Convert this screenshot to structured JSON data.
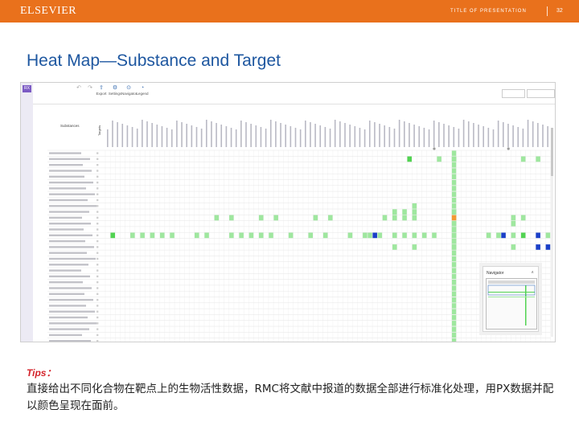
{
  "header": {
    "brand": "ELSEVIER",
    "deck_title": "TITLE OF PRESENTATION",
    "page_number": "32",
    "color": "#e9711c"
  },
  "slide": {
    "title": "Heat Map—Substance and Target",
    "tips_label": "Tips：",
    "tips_body": "直接给出不同化合物在靶点上的生物活性数据，RMC将文献中报道的数据全部进行标准化处理，用PX数据并配以颜色呈现在面前。"
  },
  "app": {
    "logo": "RX",
    "toolbar": [
      {
        "label": "Export",
        "icon": "export-icon"
      },
      {
        "label": "Settings",
        "icon": "settings-icon"
      },
      {
        "label": "Navigator",
        "icon": "navigator-icon"
      },
      {
        "label": "Legend",
        "icon": "legend-icon"
      }
    ],
    "row_header": "Substances",
    "column_header": "Targets",
    "navigator_title": "Navigator",
    "rows": 33,
    "columns": 90,
    "heat_column": 70,
    "row_marker_rows": [
      0,
      7
    ],
    "colors": {
      "green_light": "#9fe79f",
      "green": "#52d352",
      "blue": "#1a3fc8",
      "orange": "#f29a33",
      "grid_line": "#e6e6e6"
    },
    "cells": [
      [
        1,
        61,
        "g",
        "x"
      ],
      [
        1,
        67,
        "l",
        "x"
      ],
      [
        1,
        70,
        "l",
        "x"
      ],
      [
        1,
        84,
        "l",
        "x"
      ],
      [
        1,
        87,
        "l",
        "x"
      ],
      [
        9,
        62,
        "l",
        "x"
      ],
      [
        10,
        70,
        "l",
        "x"
      ],
      [
        10,
        58,
        "l",
        "x"
      ],
      [
        10,
        60,
        "l",
        "x"
      ],
      [
        10,
        62,
        "l",
        "x"
      ],
      [
        11,
        22,
        "l",
        "x"
      ],
      [
        11,
        25,
        "l",
        "x"
      ],
      [
        11,
        31,
        "l",
        "x"
      ],
      [
        11,
        34,
        "l",
        "x"
      ],
      [
        11,
        42,
        "l",
        "x"
      ],
      [
        11,
        45,
        "l",
        "x"
      ],
      [
        11,
        56,
        "l",
        "x"
      ],
      [
        11,
        58,
        "l",
        "x"
      ],
      [
        11,
        60,
        "l",
        "x"
      ],
      [
        11,
        62,
        "l",
        "x"
      ],
      [
        11,
        70,
        "o",
        "x"
      ],
      [
        11,
        82,
        "l",
        "x"
      ],
      [
        11,
        84,
        "l",
        "x"
      ],
      [
        12,
        70,
        "l",
        "x"
      ],
      [
        12,
        82,
        "l",
        "x"
      ],
      [
        13,
        70,
        "l",
        "x"
      ],
      [
        14,
        1,
        "g",
        "x"
      ],
      [
        14,
        5,
        "l",
        "x"
      ],
      [
        14,
        7,
        "l",
        "x"
      ],
      [
        14,
        9,
        "l",
        "x"
      ],
      [
        14,
        11,
        "l",
        "x"
      ],
      [
        14,
        13,
        "l",
        "x"
      ],
      [
        14,
        18,
        "l",
        "x"
      ],
      [
        14,
        20,
        "l",
        "x"
      ],
      [
        14,
        25,
        "l",
        "x"
      ],
      [
        14,
        27,
        "l",
        "x"
      ],
      [
        14,
        29,
        "l",
        "x"
      ],
      [
        14,
        31,
        "l",
        "x"
      ],
      [
        14,
        33,
        "l",
        "x"
      ],
      [
        14,
        37,
        "l",
        "x"
      ],
      [
        14,
        41,
        "l",
        "x"
      ],
      [
        14,
        44,
        "l",
        "x"
      ],
      [
        14,
        49,
        "l",
        "x"
      ],
      [
        14,
        52,
        "l",
        "x"
      ],
      [
        14,
        53,
        "l",
        "x"
      ],
      [
        14,
        54,
        "b",
        "x"
      ],
      [
        14,
        55,
        "l",
        "x"
      ],
      [
        14,
        58,
        "l",
        "x"
      ],
      [
        14,
        60,
        "l",
        "x"
      ],
      [
        14,
        62,
        "l",
        "x"
      ],
      [
        14,
        64,
        "l",
        "x"
      ],
      [
        14,
        66,
        "l",
        "x"
      ],
      [
        14,
        70,
        "l",
        "x"
      ],
      [
        14,
        77,
        "l",
        "x"
      ],
      [
        14,
        79,
        "l",
        "x"
      ],
      [
        14,
        80,
        "b",
        "x"
      ],
      [
        14,
        82,
        "l",
        "x"
      ],
      [
        14,
        84,
        "g",
        "x"
      ],
      [
        14,
        87,
        "b",
        "x"
      ],
      [
        14,
        89,
        "l",
        "x"
      ],
      [
        15,
        70,
        "l",
        "x"
      ],
      [
        16,
        58,
        "l",
        "x"
      ],
      [
        16,
        62,
        "l",
        "x"
      ],
      [
        16,
        70,
        "l",
        "x"
      ],
      [
        16,
        82,
        "l",
        "x"
      ],
      [
        16,
        87,
        "b",
        "x"
      ],
      [
        16,
        89,
        "b",
        "x"
      ]
    ]
  }
}
